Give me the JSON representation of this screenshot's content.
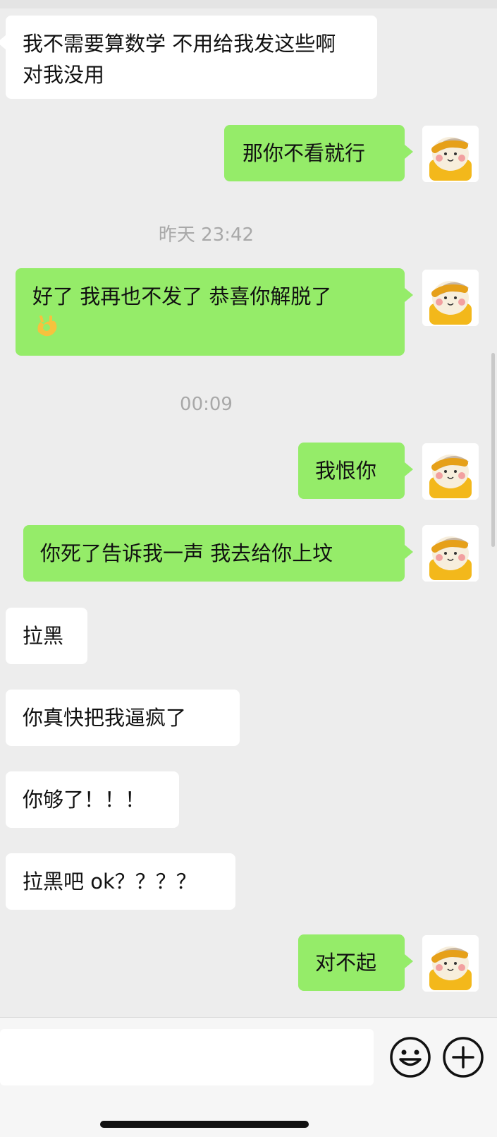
{
  "messages": [
    {
      "side": "left",
      "text": "我不需要算数学 不用给我发这些啊 对我没用"
    },
    {
      "side": "right",
      "text": "那你不看就行"
    },
    {
      "type": "time",
      "text": "昨天 23:42"
    },
    {
      "side": "right",
      "text": "好了 我再也不发了 恭喜你解脱了",
      "emoji": "ok-hand-emoji"
    },
    {
      "type": "time",
      "text": "00:09"
    },
    {
      "side": "right",
      "text": "我恨你"
    },
    {
      "side": "right",
      "text": "你死了告诉我一声 我去给你上坟"
    },
    {
      "side": "left",
      "text": "拉黑"
    },
    {
      "side": "left",
      "text": "你真快把我逼疯了"
    },
    {
      "side": "left",
      "text": "你够了！！！"
    },
    {
      "side": "left",
      "text": "拉黑吧 ok？？？？"
    },
    {
      "side": "right",
      "text": "对不起"
    }
  ],
  "input": {
    "placeholder": "",
    "emoji_icon": "smiley-face-icon",
    "plus_icon": "plus-circle-icon"
  },
  "colors": {
    "background": "#ededed",
    "bubble_right": "#95ec69",
    "bubble_left": "#ffffff",
    "timestamp": "#a8a8a8"
  }
}
